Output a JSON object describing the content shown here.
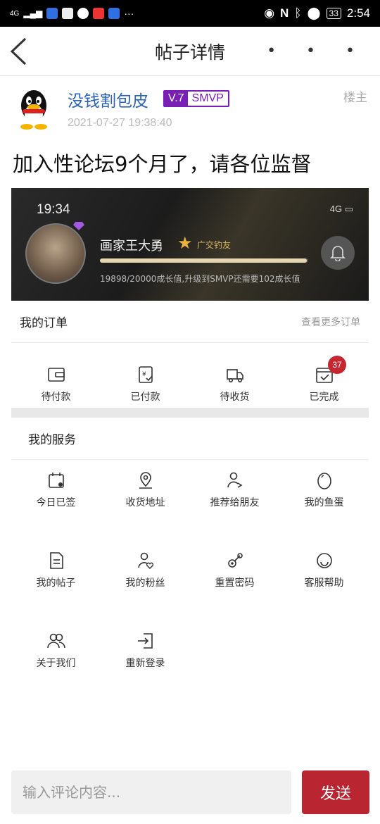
{
  "status_bar": {
    "signal": "4G",
    "battery": "33",
    "time": "2:54",
    "icons": [
      "eye-icon",
      "nfc-icon",
      "bluetooth-icon",
      "location-icon",
      "battery-icon"
    ]
  },
  "nav": {
    "title": "帖子详情",
    "more": "• • •",
    "back_icon": "chevron-left-icon"
  },
  "post": {
    "author": "没钱割包皮",
    "level": "V.7",
    "rank": "SMVP",
    "role_tag": "楼主",
    "time": "2021-07-27 19:38:40",
    "title": "加入性论坛9个月了，请各位监督"
  },
  "screenshot": {
    "clock": "19:34",
    "signal": "4G",
    "profile_name": "画家王大勇",
    "profile_tag": "广交钓友",
    "progress_text": "19898/20000成长值,升级到SMVP还需要102成长值",
    "progress_fraction": 0.9949,
    "orders_title": "我的订单",
    "orders_more": "查看更多订单",
    "orders": [
      {
        "label": "待付款",
        "icon": "wallet-icon"
      },
      {
        "label": "已付款",
        "icon": "receipt-icon"
      },
      {
        "label": "待收货",
        "icon": "truck-icon"
      },
      {
        "label": "已完成",
        "icon": "completed-icon",
        "badge": "37"
      }
    ],
    "services_title": "我的服务",
    "services": [
      {
        "label": "今日已签",
        "icon": "calendar-icon"
      },
      {
        "label": "收货地址",
        "icon": "location-icon"
      },
      {
        "label": "推荐给朋友",
        "icon": "share-user-icon"
      },
      {
        "label": "我的鱼蛋",
        "icon": "egg-icon"
      },
      {
        "label": "我的帖子",
        "icon": "document-icon"
      },
      {
        "label": "我的粉丝",
        "icon": "fans-icon"
      },
      {
        "label": "重置密码",
        "icon": "key-icon"
      },
      {
        "label": "客服帮助",
        "icon": "smile-icon"
      },
      {
        "label": "关于我们",
        "icon": "users-icon"
      },
      {
        "label": "重新登录",
        "icon": "login-icon"
      }
    ]
  },
  "composer": {
    "placeholder": "输入评论内容...",
    "send": "发送"
  },
  "colors": {
    "accent": "#b92530",
    "link": "#2a63b8",
    "vip": "#7a1fb5",
    "badge": "#c8262e"
  }
}
